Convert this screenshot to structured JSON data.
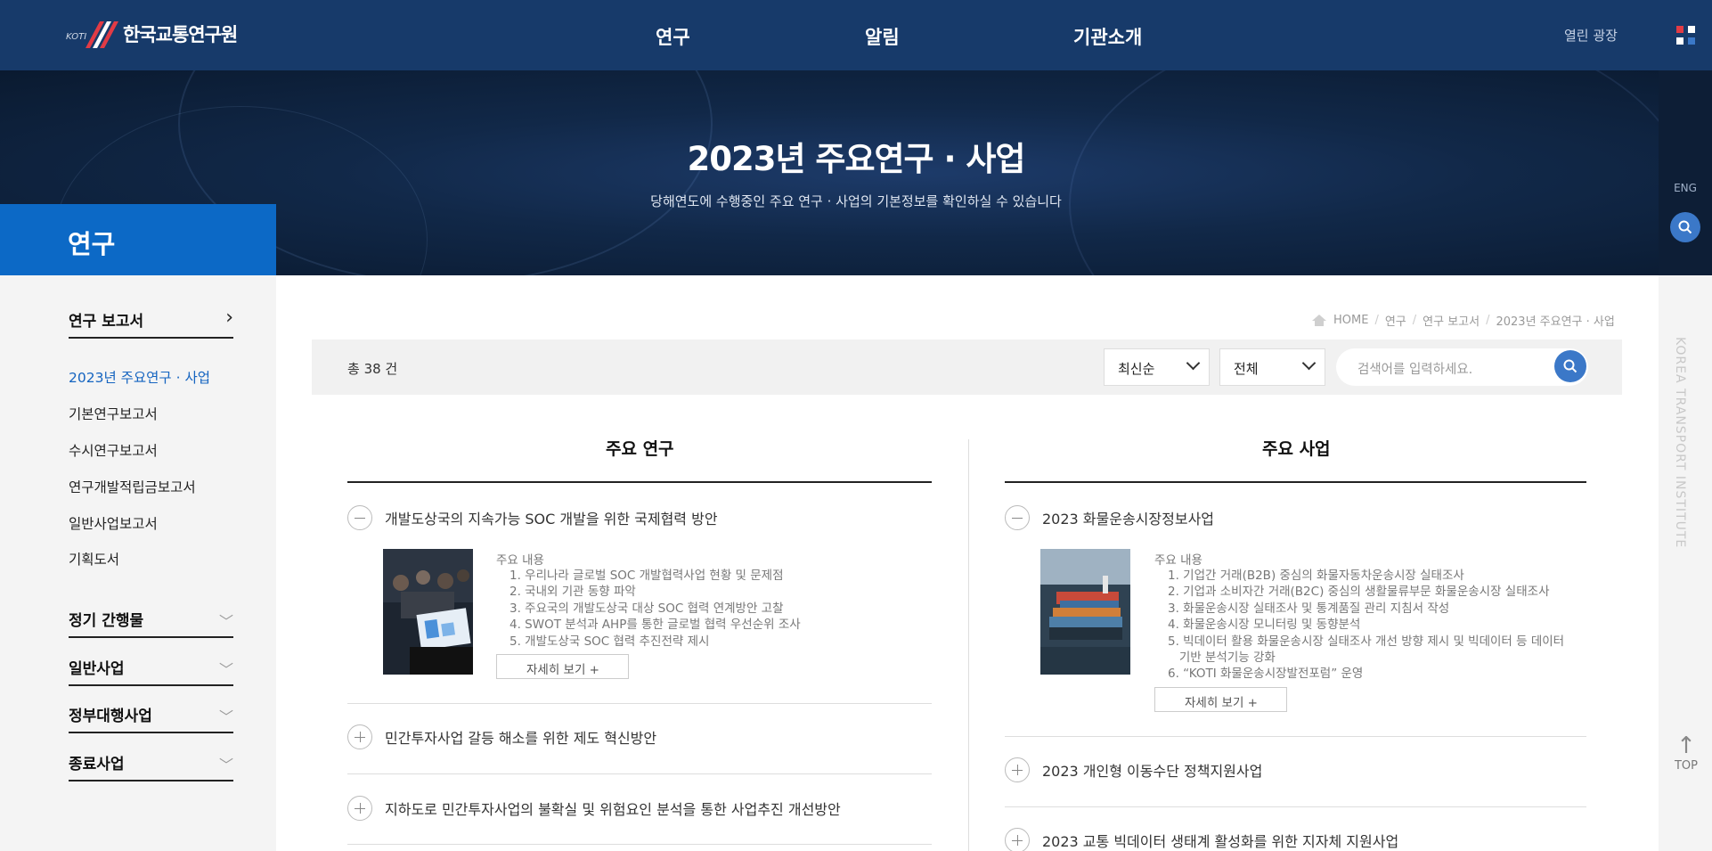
{
  "header": {
    "logo_prefix": "KOTI",
    "logo_text": "한국교통연구원",
    "nav": [
      "연구",
      "알림",
      "기관소개"
    ],
    "util_link": "열린 광장"
  },
  "rail": {
    "lang": "ENG",
    "vertical_text": "KOREA TRANSPORT INSTITUTE",
    "top_label": "TOP",
    "top_arrow": "↑"
  },
  "hero": {
    "title": "2023년 주요연구 · 사업",
    "subtitle": "당해연도에 수행중인 주요 연구 · 사업의 기본정보를 확인하실 수 있습니다"
  },
  "sidebar": {
    "section": "연구",
    "groups": [
      {
        "label": "연구 보고서",
        "icon": "chevron-right"
      },
      {
        "label": "정기 간행물",
        "icon": "chevron-down"
      },
      {
        "label": "일반사업",
        "icon": "chevron-down"
      },
      {
        "label": "정부대행사업",
        "icon": "chevron-down"
      },
      {
        "label": "종료사업",
        "icon": "chevron-down"
      }
    ],
    "sub_items": [
      "2023년 주요연구 · 사업",
      "기본연구보고서",
      "수시연구보고서",
      "연구개발적립금보고서",
      "일반사업보고서",
      "기획도서"
    ]
  },
  "breadcrumb": [
    "HOME",
    "연구",
    "연구 보고서",
    "2023년 주요연구 · 사업"
  ],
  "filter": {
    "total": "총 38 건",
    "sort_selected": "최신순",
    "type_selected": "전체",
    "search_placeholder": "검색어를 입력하세요."
  },
  "columns": {
    "research": {
      "title": "주요 연구",
      "open_item": "개발도상국의 지속가능 SOC 개발을 위한 국제협력 방안",
      "detail_label": "주요 내용",
      "details": [
        "1. 우리나라 글로벌 SOC 개발협력사업 현황 및 문제점",
        "2. 국내외 기관 동향 파악",
        "3. 주요국의 개발도상국 대상 SOC 협력 연계방안 고찰",
        "4. SWOT 분석과 AHP를 통한 글로벌 협력 우선순위 조사",
        "5. 개발도상국 SOC 협력 추진전략 제시"
      ],
      "more": "자세히 보기 +",
      "items": [
        "민간투자사업 갈등 해소를 위한 제도 혁신방안",
        "지하도로 민간투자사업의 불확실 및 위험요인 분석을 통한 사업추진 개선방안"
      ]
    },
    "business": {
      "title": "주요 사업",
      "open_item": "2023 화물운송시장정보사업",
      "detail_label": "주요 내용",
      "details": [
        "1. 기업간 거래(B2B) 중심의 화물자동차운송시장 실태조사",
        "2. 기업과 소비자간 거래(B2C) 중심의 생활물류부문 화물운송시장 실태조사",
        "3. 화물운송시장 실태조사 및 통계품질 관리 지침서 작성",
        "4. 화물운송시장 모니터링 및 동향분석",
        "5. 빅데이터 활용 화물운송시장 실태조사 개선 방향 제시 및 빅데이터 등 데이터",
        "   기반 분석기능 강화",
        "6. “KOTI 화물운송시장발전포럼” 운영"
      ],
      "more": "자세히 보기 +",
      "items": [
        "2023 개인형 이동수단 정책지원사업",
        "2023 교통 빅데이터 생태계 활성화를 위한 지자체 지원사업"
      ]
    }
  },
  "colors": {
    "header": "#173a6a",
    "accent": "#0c69c6",
    "search_button": "#3b78c8",
    "logo_red": "#e23b45"
  }
}
